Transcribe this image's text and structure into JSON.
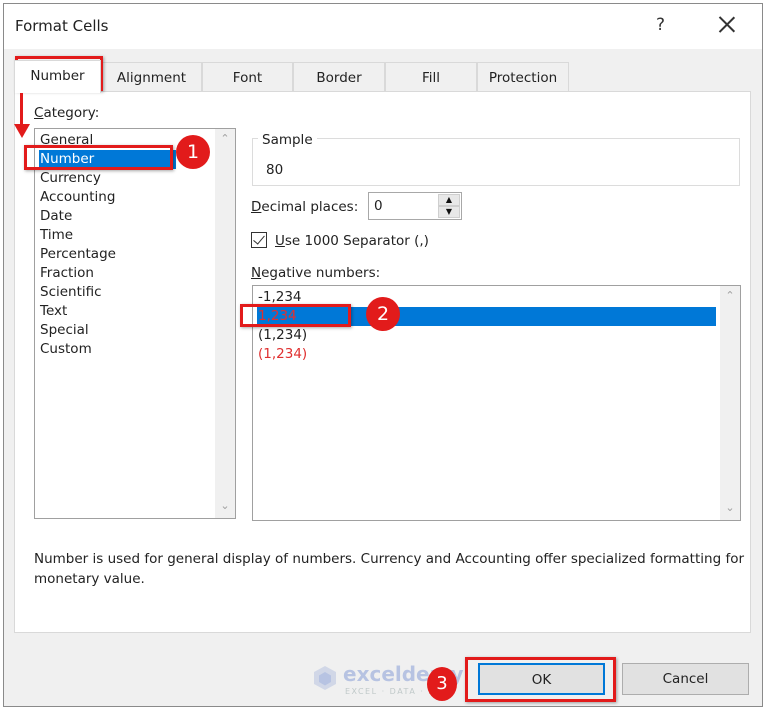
{
  "window": {
    "title": "Format Cells",
    "help_label": "?",
    "close_label": "close"
  },
  "tabs": [
    {
      "label": "Number",
      "active": true
    },
    {
      "label": "Alignment",
      "active": false
    },
    {
      "label": "Font",
      "active": false
    },
    {
      "label": "Border",
      "active": false
    },
    {
      "label": "Fill",
      "active": false
    },
    {
      "label": "Protection",
      "active": false
    }
  ],
  "category": {
    "label_accel": "C",
    "label_rest": "ategory:",
    "items": [
      "General",
      "Number",
      "Currency",
      "Accounting",
      "Date",
      "Time",
      "Percentage",
      "Fraction",
      "Scientific",
      "Text",
      "Special",
      "Custom"
    ],
    "selected": "Number"
  },
  "sample": {
    "label": "Sample",
    "value": "80"
  },
  "decimal_places": {
    "label_accel": "D",
    "label_rest": "ecimal places:",
    "value": "0"
  },
  "separator": {
    "label_accel": "U",
    "label_rest": "se 1000 Separator (,)",
    "checked": true
  },
  "negative_numbers": {
    "label_accel": "N",
    "label_rest": "egative numbers:",
    "items": [
      {
        "text": "-1,234",
        "color": "#222222"
      },
      {
        "text": "1,234",
        "color": "#e03030"
      },
      {
        "text": "(1,234)",
        "color": "#222222"
      },
      {
        "text": "(1,234)",
        "color": "#e03030"
      }
    ],
    "selected_index": 1
  },
  "description": "Number is used for general display of numbers.  Currency and Accounting offer specialized formatting for monetary value.",
  "buttons": {
    "ok": "OK",
    "cancel": "Cancel"
  },
  "annotations": {
    "badge_1": "1",
    "badge_2": "2",
    "badge_3": "3",
    "color": "#e21b1b"
  },
  "watermark": {
    "name": "exceldemy",
    "tagline": "EXCEL · DATA · BI"
  },
  "colors": {
    "selection": "#0078d7",
    "dialog_bg": "#f0f0f0",
    "negative_red": "#e03030"
  }
}
